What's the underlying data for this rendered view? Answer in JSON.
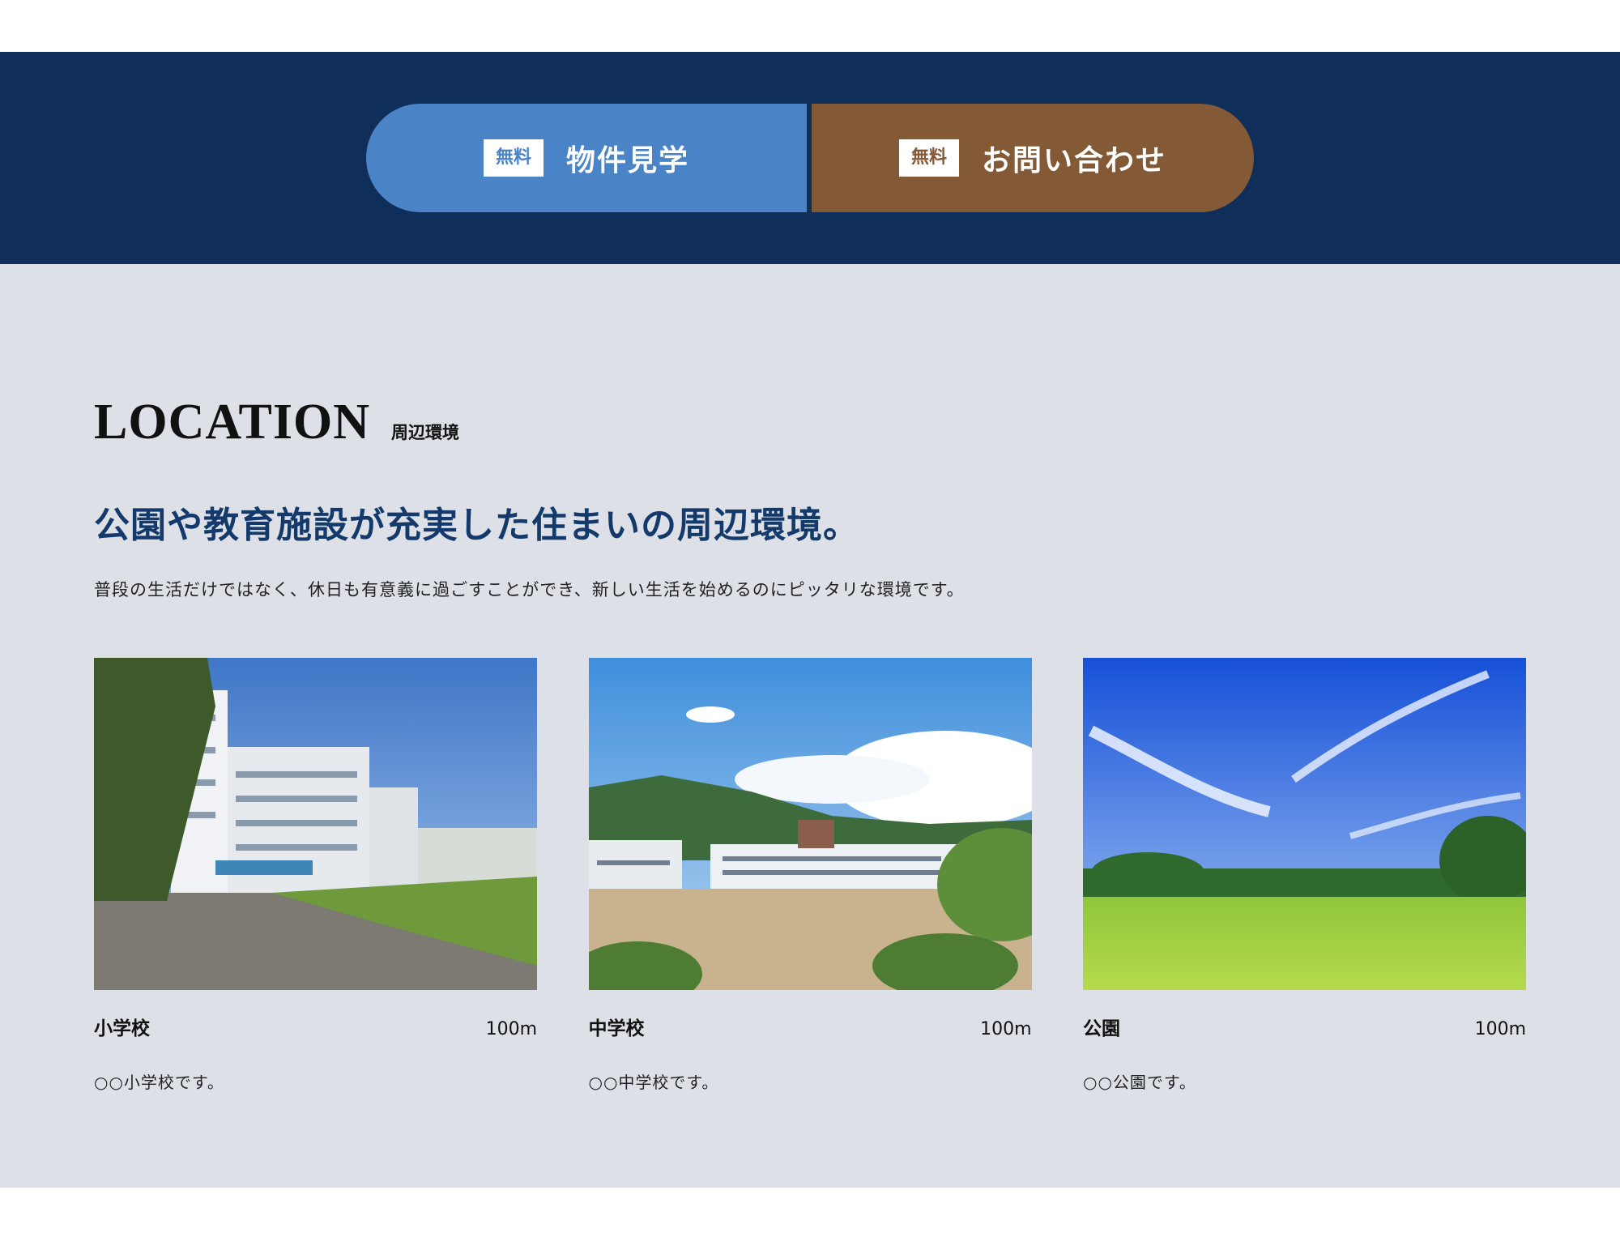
{
  "cta": {
    "tour": {
      "badge": "無料",
      "label": "物件見学",
      "color": "#4a83c6"
    },
    "contact": {
      "badge": "無料",
      "label": "お問い合わせ",
      "color": "#845a36"
    },
    "band_color": "#0f2f5a"
  },
  "location": {
    "heading_en": "LOCATION",
    "heading_ja": "周辺環境",
    "lead": "公園や教育施設が充実した住まいの周辺環境。",
    "description": "普段の生活だけではなく、休日も有意義に過ごすことができ、新しい生活を始めるのにピッタリな環境です。",
    "background": "#dde0e7",
    "cards": [
      {
        "name": "小学校",
        "distance": "100m",
        "text": "○○小学校です。",
        "photo": "elementary-school-photo"
      },
      {
        "name": "中学校",
        "distance": "100m",
        "text": "○○中学校です。",
        "photo": "junior-high-school-photo"
      },
      {
        "name": "公園",
        "distance": "100m",
        "text": "○○公園です。",
        "photo": "park-photo"
      }
    ]
  }
}
